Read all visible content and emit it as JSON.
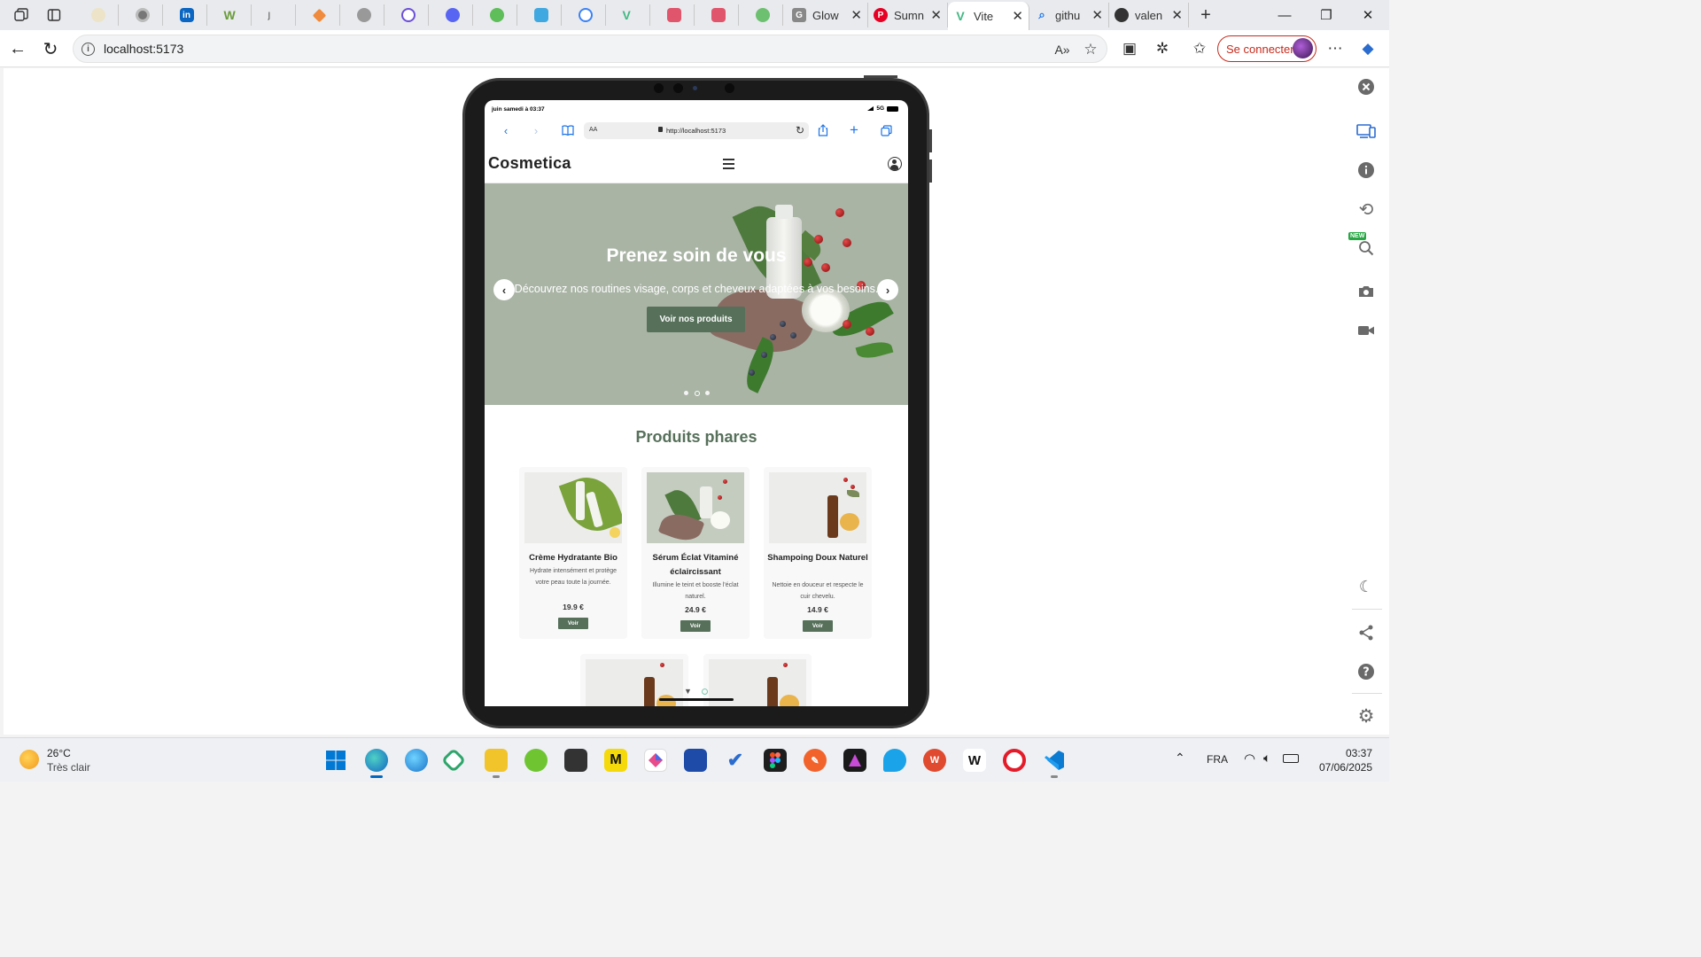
{
  "browser": {
    "tabs": [
      {
        "title": "Glow",
        "active": false
      },
      {
        "title": "Sumn",
        "active": false
      },
      {
        "title": "Vite",
        "active": true
      },
      {
        "title": "githu",
        "active": false
      },
      {
        "title": "valen",
        "active": false
      }
    ],
    "address": "localhost:5173",
    "signin_label": "Se connecter"
  },
  "device": {
    "status_time": "juin samedi à 03:37",
    "network": "5G",
    "safari_text_size": "AA",
    "safari_url": "http://localhost:5173"
  },
  "site": {
    "logo": "Cosmetica",
    "hero": {
      "title": "Prenez soin de vous",
      "subtitle": "Découvrez nos routines visage, corps et cheveux adaptées à vos besoins.",
      "cta": "Voir nos produits",
      "slide_count": 3,
      "active_slide": 2
    },
    "featured_title": "Produits phares",
    "products": [
      {
        "name": "Crème Hydratante Bio",
        "desc": "Hydrate intensément et protège votre peau toute la journée.",
        "price": "19.9 €",
        "button": "Voir"
      },
      {
        "name": "Sérum Éclat Vitaminé éclaircissant",
        "desc": "Illumine le teint et booste l'éclat naturel.",
        "price": "24.9 €",
        "button": "Voir"
      },
      {
        "name": "Shampoing Doux Naturel",
        "desc": "Nettoie en douceur et respecte le cuir chevelu.",
        "price": "14.9 €",
        "button": "Voir"
      }
    ]
  },
  "devtools": {
    "new_badge": "NEW"
  },
  "taskbar": {
    "temperature": "26°C",
    "condition": "Très clair",
    "language": "FRA",
    "time": "03:37",
    "date": "07/06/2025"
  },
  "colors": {
    "brand_green": "#56705a",
    "hero_bg": "#a9b4a5",
    "edge_red": "#c42b1c"
  }
}
